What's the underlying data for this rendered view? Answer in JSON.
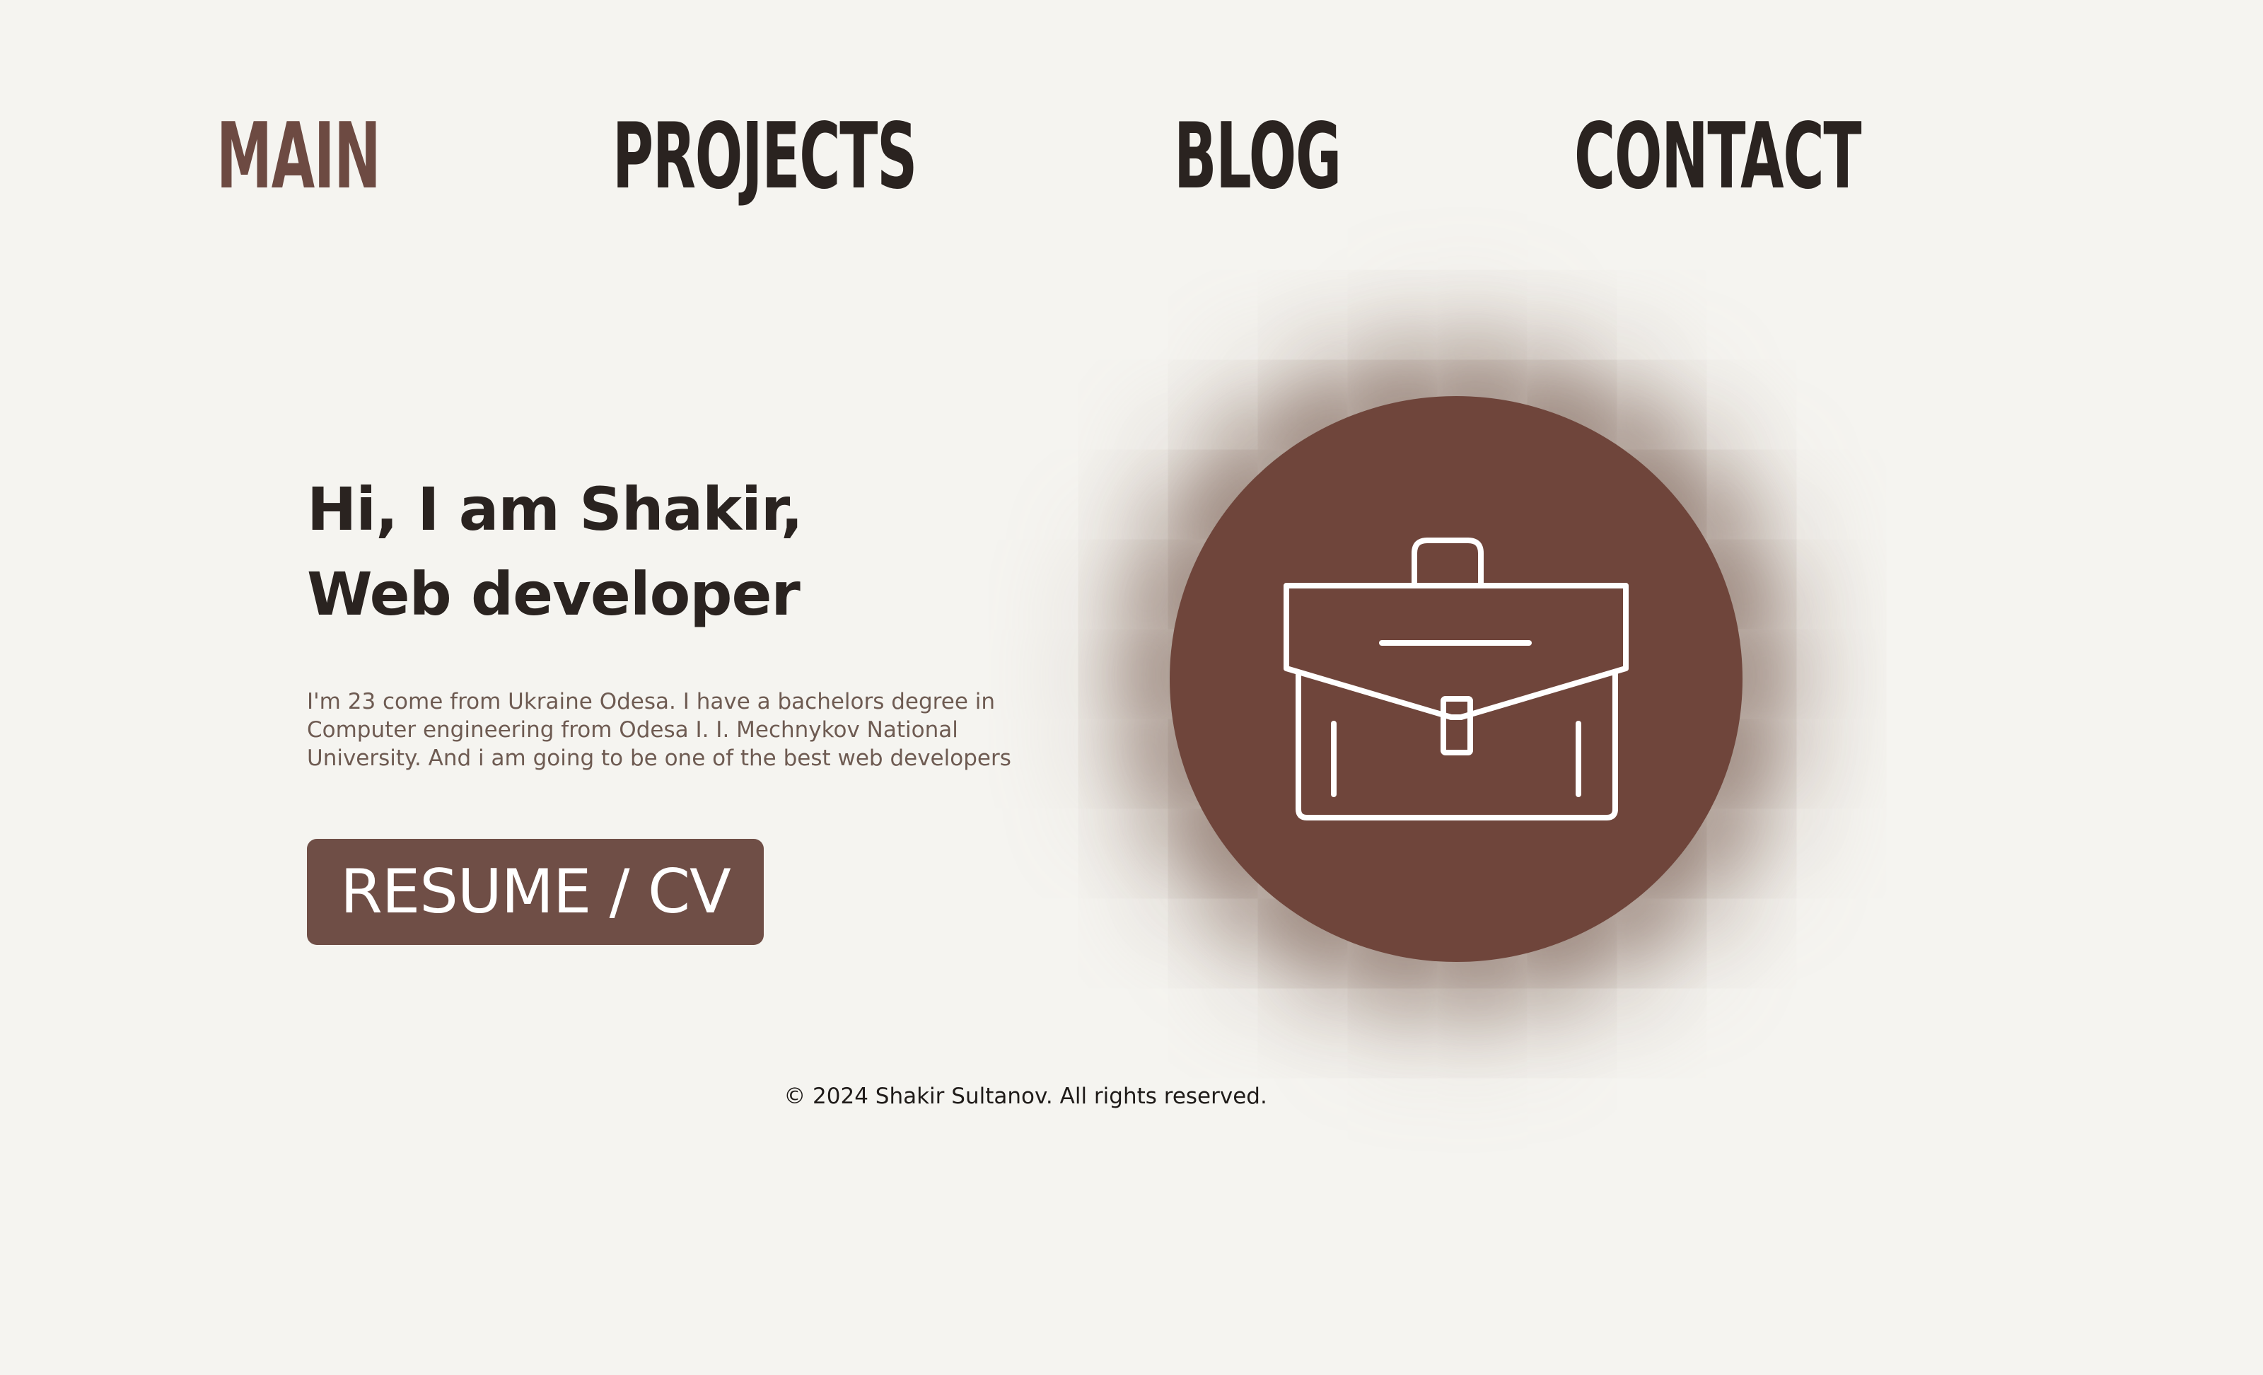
{
  "nav": {
    "items": [
      {
        "label": "MAIN",
        "active": true
      },
      {
        "label": "PROJECTS",
        "active": false
      },
      {
        "label": "BLOG",
        "active": false
      },
      {
        "label": "CONTACT",
        "active": false
      }
    ]
  },
  "hero": {
    "headline_line1": "Hi, I am Shakir,",
    "headline_line2": "Web developer",
    "bio": "I'm 23 come from Ukraine Odesa. I have a bachelors degree in Computer engineering from Odesa I. I. Mechnykov National University. And i am going to be one of the best web developers",
    "resume_button_label": "RESUME / CV",
    "icon": "briefcase-icon"
  },
  "footer": {
    "copyright": "© 2024 Shakir Sultanov. All rights reserved."
  },
  "colors": {
    "background": "#f5f4f0",
    "accent": "#6f4e46",
    "active_nav": "#6d4a42",
    "text_dark": "#2a2320",
    "text_muted": "#6e5b52"
  }
}
